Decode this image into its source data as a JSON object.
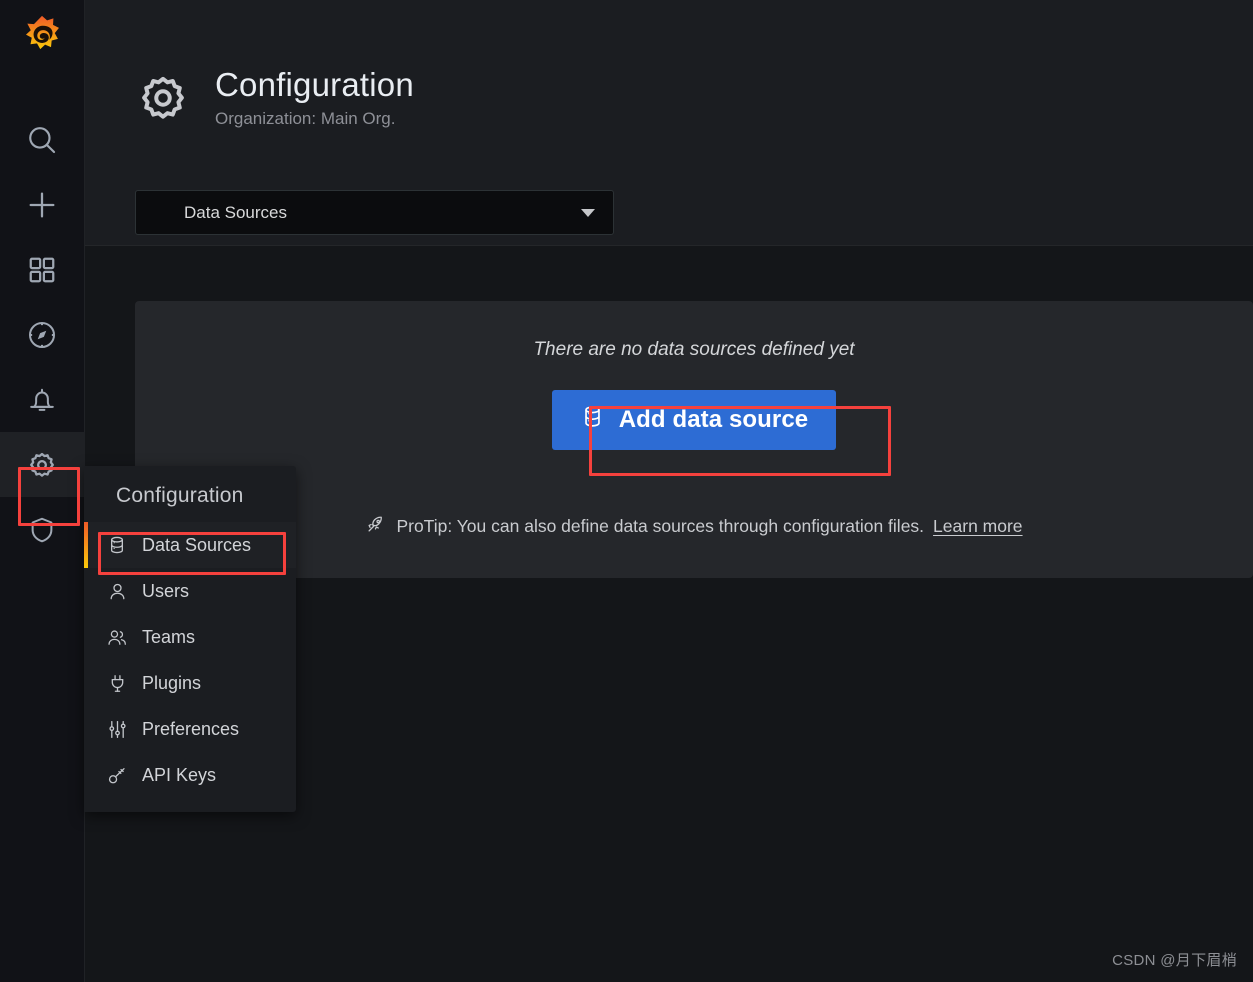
{
  "sidebar": {
    "brand_icon": "grafana-logo",
    "items": [
      {
        "id": "search",
        "icon": "search-icon",
        "label": "Search"
      },
      {
        "id": "create",
        "icon": "plus-icon",
        "label": "Create"
      },
      {
        "id": "dash",
        "icon": "dashboards-icon",
        "label": "Dashboards"
      },
      {
        "id": "explore",
        "icon": "compass-icon",
        "label": "Explore"
      },
      {
        "id": "alert",
        "icon": "bell-icon",
        "label": "Alerting"
      },
      {
        "id": "config",
        "icon": "gear-icon",
        "label": "Configuration"
      },
      {
        "id": "shield",
        "icon": "shield-icon",
        "label": "Server Admin"
      }
    ]
  },
  "flyout": {
    "header": "Configuration",
    "accent_colors": [
      "#f05a28",
      "#fbca0a"
    ],
    "items": [
      {
        "label": "Data Sources",
        "icon": "database-icon",
        "active": true
      },
      {
        "label": "Users",
        "icon": "user-icon",
        "active": false
      },
      {
        "label": "Teams",
        "icon": "users-icon",
        "active": false
      },
      {
        "label": "Plugins",
        "icon": "plug-icon",
        "active": false
      },
      {
        "label": "Preferences",
        "icon": "sliders-icon",
        "active": false
      },
      {
        "label": "API Keys",
        "icon": "key-icon",
        "active": false
      }
    ]
  },
  "header": {
    "icon": "gear-icon",
    "title": "Configuration",
    "subtitle": "Organization: Main Org.",
    "selector_value": "Data Sources",
    "selector_caret": "chevron-down-icon"
  },
  "panel": {
    "empty_message": "There are no data sources defined yet",
    "add_button_label": "Add data source",
    "add_button_icon": "database-icon",
    "add_button_color": "#2d6cd4",
    "protip_icon": "rocket-icon",
    "protip_text": "ProTip: You can also define data sources through configuration files.",
    "protip_link": "Learn more"
  },
  "annotations": {
    "color": "#f5413d",
    "boxes": [
      "gear-sidebar-icon",
      "data-sources-menu-item",
      "add-data-source-button"
    ]
  },
  "watermark": "CSDN @月下眉梢"
}
